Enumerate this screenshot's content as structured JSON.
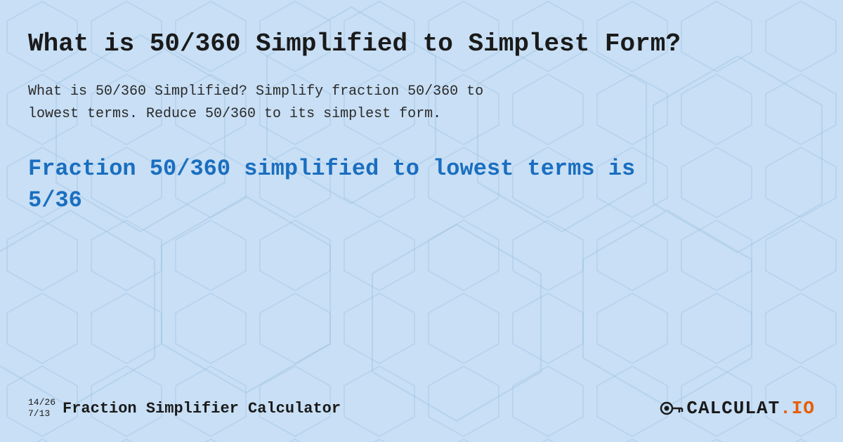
{
  "page": {
    "title": "What is 50/360 Simplified to Simplest Form?",
    "description_line1": "What is 50/360 Simplified? Simplify fraction 50/360 to",
    "description_line2": "lowest terms. Reduce 50/360 to its simplest form.",
    "result_heading_line1": "Fraction 50/360 simplified to lowest terms is",
    "result_heading_line2": "5/36",
    "footer": {
      "fraction1": "14/26",
      "fraction2": "7/13",
      "brand_label": "Fraction Simplifier Calculator",
      "logo_text_main": "CALCULAT",
      "logo_text_accent": ".IO"
    }
  },
  "background": {
    "color": "#c8dff5"
  }
}
